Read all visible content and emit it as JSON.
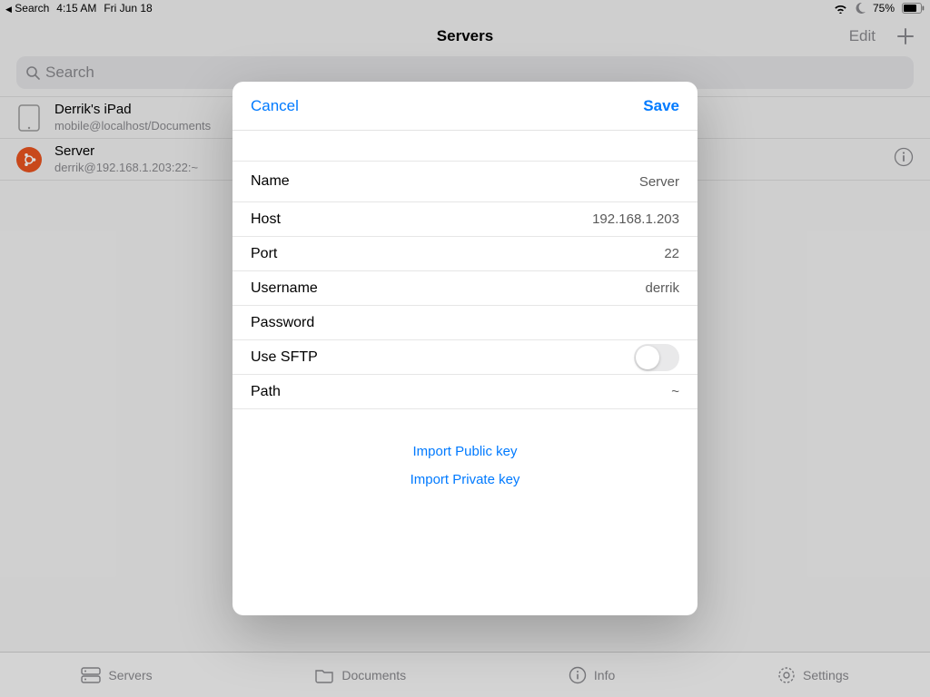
{
  "statusbar": {
    "back_label": "Search",
    "time": "4:15 AM",
    "date": "Fri Jun 18",
    "battery": "75%"
  },
  "header": {
    "title": "Servers",
    "edit": "Edit"
  },
  "search": {
    "placeholder": "Search"
  },
  "list": [
    {
      "title": "Derrik's iPad",
      "sub": "mobile@localhost/Documents"
    },
    {
      "title": "Server",
      "sub": "derrik@192.168.1.203:22:~"
    }
  ],
  "modal": {
    "cancel": "Cancel",
    "save": "Save",
    "rows": {
      "name_label": "Name",
      "name_value": "Server",
      "host_label": "Host",
      "host_value": "192.168.1.203",
      "port_label": "Port",
      "port_value": "22",
      "user_label": "Username",
      "user_value": "derrik",
      "pass_label": "Password",
      "pass_value": "",
      "sftp_label": "Use SFTP",
      "path_label": "Path",
      "path_value": "~"
    },
    "links": {
      "pubkey": "Import Public key",
      "privkey": "Import Private key"
    }
  },
  "tabs": {
    "servers": "Servers",
    "documents": "Documents",
    "info": "Info",
    "settings": "Settings"
  }
}
